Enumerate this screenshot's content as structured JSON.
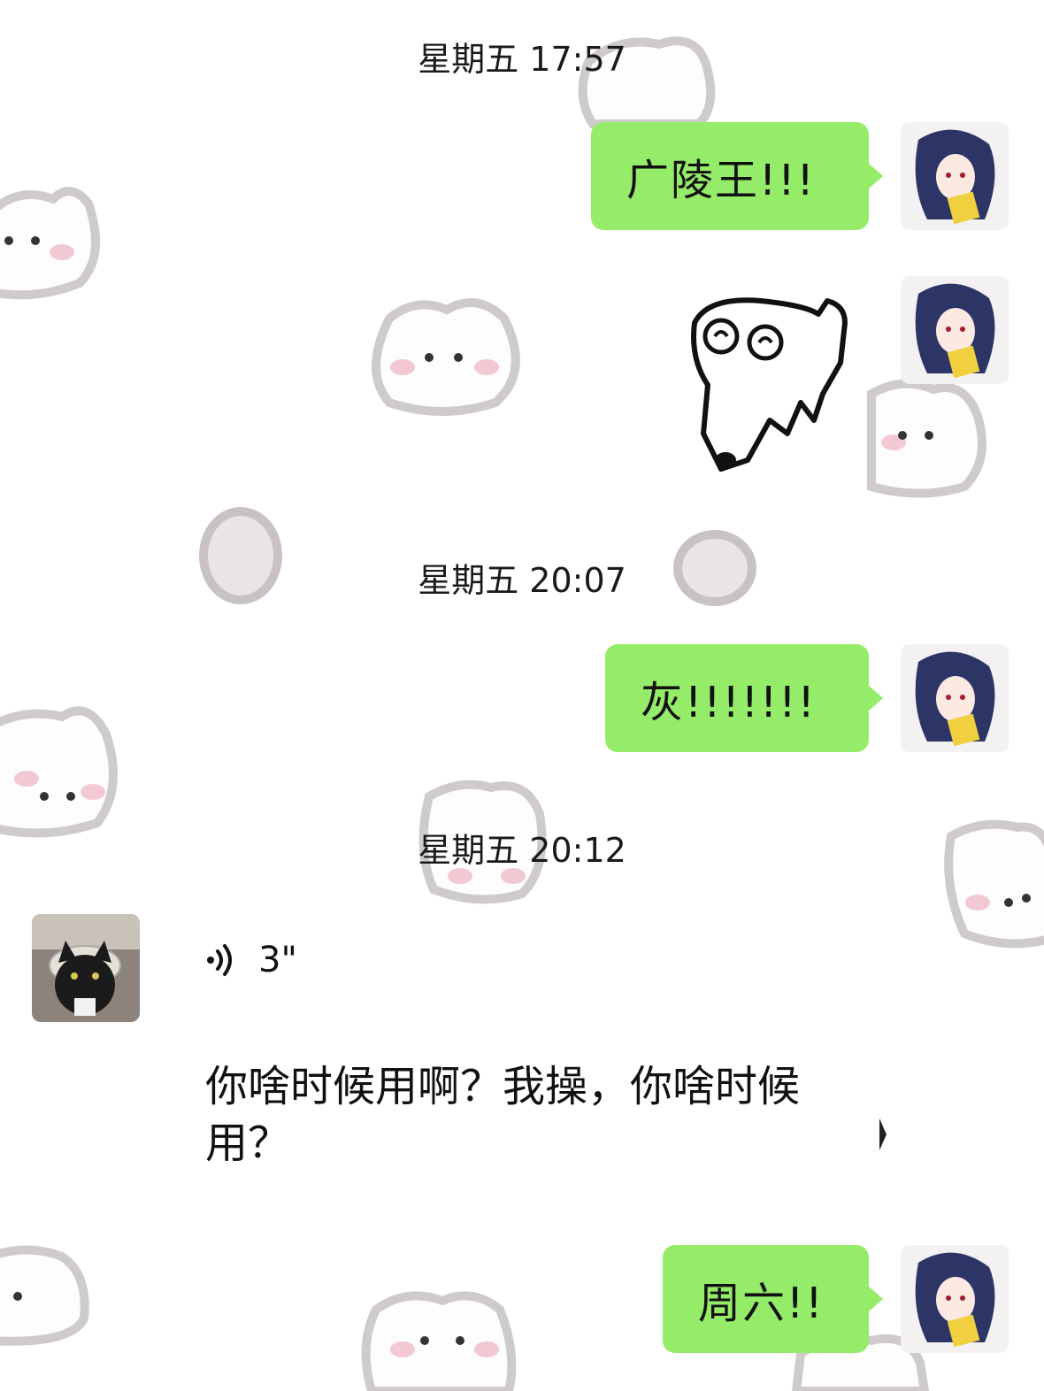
{
  "messages": [
    {
      "type": "timestamp",
      "text": "星期五 17:57"
    },
    {
      "type": "sent_text",
      "text": "广陵王!!!"
    },
    {
      "type": "sent_sticker",
      "icon": "pixel-dog-sticker-icon"
    },
    {
      "type": "timestamp",
      "text": "星期五 20:07"
    },
    {
      "type": "sent_text",
      "text": "灰!!!!!!!"
    },
    {
      "type": "timestamp",
      "text": "星期五 20:12"
    },
    {
      "type": "received_voice",
      "duration": "3\"",
      "transcript": "你啥时候用啊？我操，你啥时候用？"
    },
    {
      "type": "sent_text",
      "text": "周六!!"
    }
  ],
  "colors": {
    "sent_bubble": "#95ec69",
    "background": "#ffffff"
  }
}
